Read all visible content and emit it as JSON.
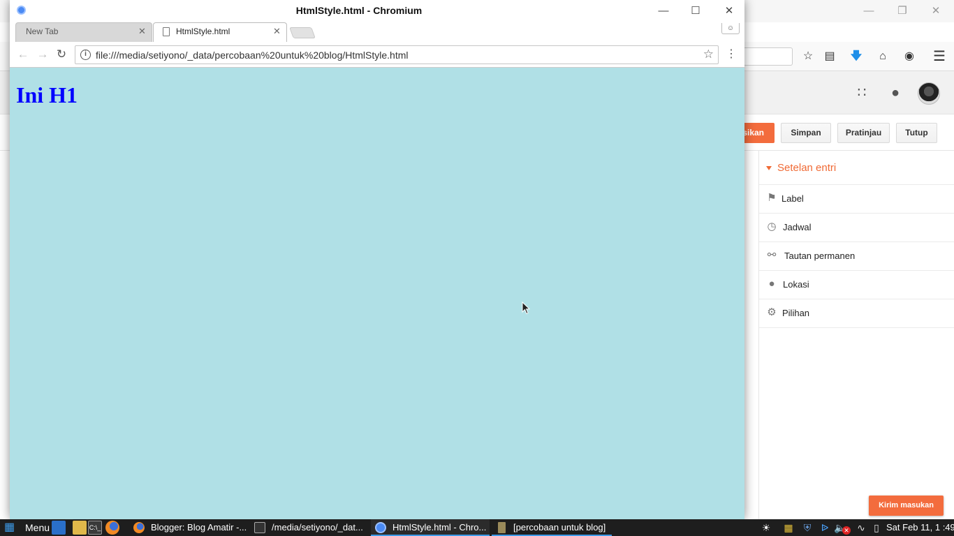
{
  "chromium": {
    "window_title": "HtmlStyle.html - Chromium",
    "tabs": [
      {
        "title": "New Tab",
        "active": false
      },
      {
        "title": "HtmlStyle.html",
        "active": true
      }
    ],
    "url": "file:///media/setiyono/_data/percobaan%20untuk%20blog/HtmlStyle.html",
    "page": {
      "heading": "Ini H1",
      "background_color": "#b0e0e6",
      "heading_color": "#0000ff"
    }
  },
  "blogger": {
    "buttons": {
      "publish_partial": "sikan",
      "save": "Simpan",
      "preview": "Pratinjau",
      "close": "Tutup"
    },
    "settings": {
      "title": "Setelan entri",
      "items": [
        {
          "label": "Label",
          "icon": "tag-icon"
        },
        {
          "label": "Jadwal",
          "icon": "clock-icon"
        },
        {
          "label": "Tautan permanen",
          "icon": "link-icon"
        },
        {
          "label": "Lokasi",
          "icon": "location-pin-icon"
        },
        {
          "label": "Pilihan",
          "icon": "gear-icon"
        }
      ]
    },
    "feedback": "Kirim masukan",
    "accent_color": "#f36c3d"
  },
  "taskbar": {
    "menu_label": "Menu",
    "tasks": [
      {
        "label": "Blogger: Blog Amatir -...",
        "icon": "firefox-icon",
        "active": false
      },
      {
        "label": "/media/setiyono/_dat...",
        "icon": "terminal-icon",
        "active": false
      },
      {
        "label": "HtmlStyle.html - Chro...",
        "icon": "chromium-icon",
        "active": true
      },
      {
        "label": "[percobaan untuk blog]",
        "icon": "folder-icon",
        "active": false
      }
    ],
    "clock": "Sat Feb 11, 1 :49"
  }
}
